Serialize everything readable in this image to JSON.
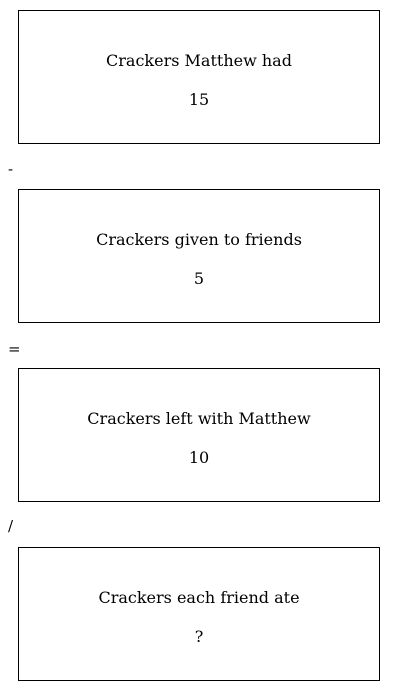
{
  "boxes": [
    {
      "label": "Crackers Matthew had",
      "value": "15"
    },
    {
      "label": "Crackers given to friends",
      "value": "5"
    },
    {
      "label": "Crackers left with Matthew",
      "value": "10"
    },
    {
      "label": "Crackers each friend ate",
      "value": "?"
    }
  ],
  "operators": [
    "-",
    "=",
    "/"
  ]
}
